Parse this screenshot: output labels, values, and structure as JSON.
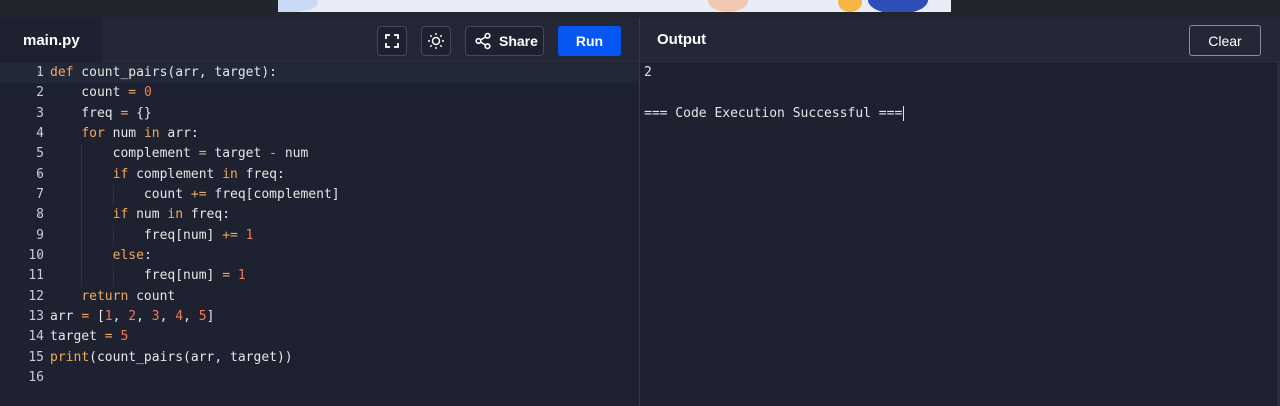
{
  "editor": {
    "file_tab": "main.py",
    "buttons": {
      "fullscreen_icon": "expand-icon",
      "theme_icon": "sun-icon",
      "share_label": "Share",
      "run_label": "Run"
    },
    "code_lines": [
      {
        "n": "1",
        "tokens": [
          [
            "kw",
            "def"
          ],
          [
            "t",
            " count_pairs(arr, target):"
          ]
        ]
      },
      {
        "n": "2",
        "tokens": [
          [
            "t",
            "    count "
          ],
          [
            "op",
            "="
          ],
          [
            "t",
            " "
          ],
          [
            "numlit",
            "0"
          ]
        ]
      },
      {
        "n": "3",
        "tokens": [
          [
            "t",
            "    freq "
          ],
          [
            "op",
            "="
          ],
          [
            "t",
            " {}"
          ]
        ]
      },
      {
        "n": "4",
        "tokens": [
          [
            "t",
            "    "
          ],
          [
            "kw",
            "for"
          ],
          [
            "t",
            " num "
          ],
          [
            "kw",
            "in"
          ],
          [
            "t",
            " arr:"
          ]
        ]
      },
      {
        "n": "5",
        "tokens": [
          [
            "t",
            "        complement "
          ],
          [
            "op",
            "="
          ],
          [
            "t",
            " target "
          ],
          [
            "op",
            "-"
          ],
          [
            "t",
            " num"
          ]
        ]
      },
      {
        "n": "6",
        "tokens": [
          [
            "t",
            "        "
          ],
          [
            "kw",
            "if"
          ],
          [
            "t",
            " complement "
          ],
          [
            "kw",
            "in"
          ],
          [
            "t",
            " freq:"
          ]
        ]
      },
      {
        "n": "7",
        "tokens": [
          [
            "t",
            "            count "
          ],
          [
            "op",
            "+="
          ],
          [
            "t",
            " freq[complement]"
          ]
        ]
      },
      {
        "n": "8",
        "tokens": [
          [
            "t",
            "        "
          ],
          [
            "kw",
            "if"
          ],
          [
            "t",
            " num "
          ],
          [
            "kw",
            "in"
          ],
          [
            "t",
            " freq:"
          ]
        ]
      },
      {
        "n": "9",
        "tokens": [
          [
            "t",
            "            freq[num] "
          ],
          [
            "op",
            "+="
          ],
          [
            "t",
            " "
          ],
          [
            "numlit",
            "1"
          ]
        ]
      },
      {
        "n": "10",
        "tokens": [
          [
            "t",
            "        "
          ],
          [
            "kw",
            "else"
          ],
          [
            "t",
            ":"
          ]
        ]
      },
      {
        "n": "11",
        "tokens": [
          [
            "t",
            "            freq[num] "
          ],
          [
            "op",
            "="
          ],
          [
            "t",
            " "
          ],
          [
            "numlit",
            "1"
          ]
        ]
      },
      {
        "n": "12",
        "tokens": [
          [
            "t",
            "    "
          ],
          [
            "kw",
            "return"
          ],
          [
            "t",
            " count"
          ]
        ]
      },
      {
        "n": "13",
        "tokens": [
          [
            "t",
            "arr "
          ],
          [
            "op",
            "="
          ],
          [
            "t",
            " ["
          ],
          [
            "numlit",
            "1"
          ],
          [
            "t",
            ", "
          ],
          [
            "numlit",
            "2"
          ],
          [
            "t",
            ", "
          ],
          [
            "numlit",
            "3"
          ],
          [
            "t",
            ", "
          ],
          [
            "numlit",
            "4"
          ],
          [
            "t",
            ", "
          ],
          [
            "numlit",
            "5"
          ],
          [
            "t",
            "]"
          ]
        ]
      },
      {
        "n": "14",
        "tokens": [
          [
            "t",
            "target "
          ],
          [
            "op",
            "="
          ],
          [
            "t",
            " "
          ],
          [
            "numlit",
            "5"
          ]
        ]
      },
      {
        "n": "15",
        "tokens": [
          [
            "kw",
            "print"
          ],
          [
            "t",
            "(count_pairs(arr, target))"
          ]
        ]
      },
      {
        "n": "16",
        "tokens": []
      }
    ],
    "foldable_lines": [
      "1",
      "4",
      "6",
      "8",
      "10"
    ],
    "active_line": "1"
  },
  "output": {
    "title": "Output",
    "clear_label": "Clear",
    "lines": [
      "2",
      "",
      "=== Code Execution Successful ==="
    ]
  },
  "colors": {
    "run_button": "#0556f3",
    "keyword": "#f0a95f",
    "number": "#f3795a",
    "background": "#1d2130"
  }
}
